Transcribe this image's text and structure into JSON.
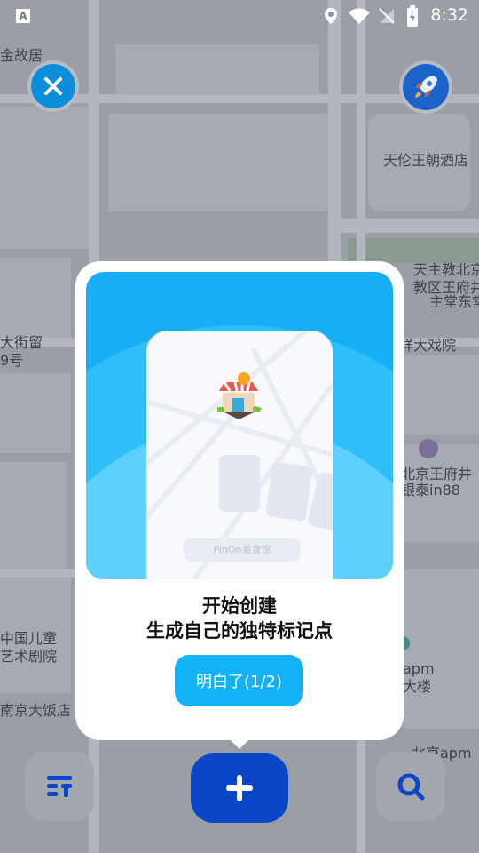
{
  "status_bar": {
    "time": "8:32",
    "notification_badge": "A"
  },
  "map": {
    "labels": {
      "top_left": "金故居",
      "hotel": "天伦王朝酒店",
      "church": [
        "天主教北京",
        "教区王府井",
        "主堂东堂"
      ],
      "street": [
        "大街留",
        "9号"
      ],
      "theater": "祥大戏院",
      "mall": [
        "北京王府井",
        "银泰in88"
      ],
      "children_theater": [
        "中国儿童",
        "艺术剧院"
      ],
      "hotel2": "南京大饭店",
      "apm": [
        "apm",
        "大楼"
      ],
      "apm2": "北京apm"
    }
  },
  "top_buttons": {
    "close_icon": "close-icon",
    "rocket_icon": "rocket-icon"
  },
  "onboarding": {
    "card_caption": "PinOn美食馆",
    "title_line1": "开始创建",
    "title_line2": "生成自己的独特标记点",
    "confirm_label": "明白了(1/2)"
  },
  "bottom_bar": {
    "filter_icon": "filter-icon",
    "add_icon": "plus-icon",
    "search_icon": "search-icon"
  },
  "colors": {
    "accent": "#12b3f6",
    "primary_dark": "#0a47c8",
    "close_blue": "#0c8fd8"
  }
}
